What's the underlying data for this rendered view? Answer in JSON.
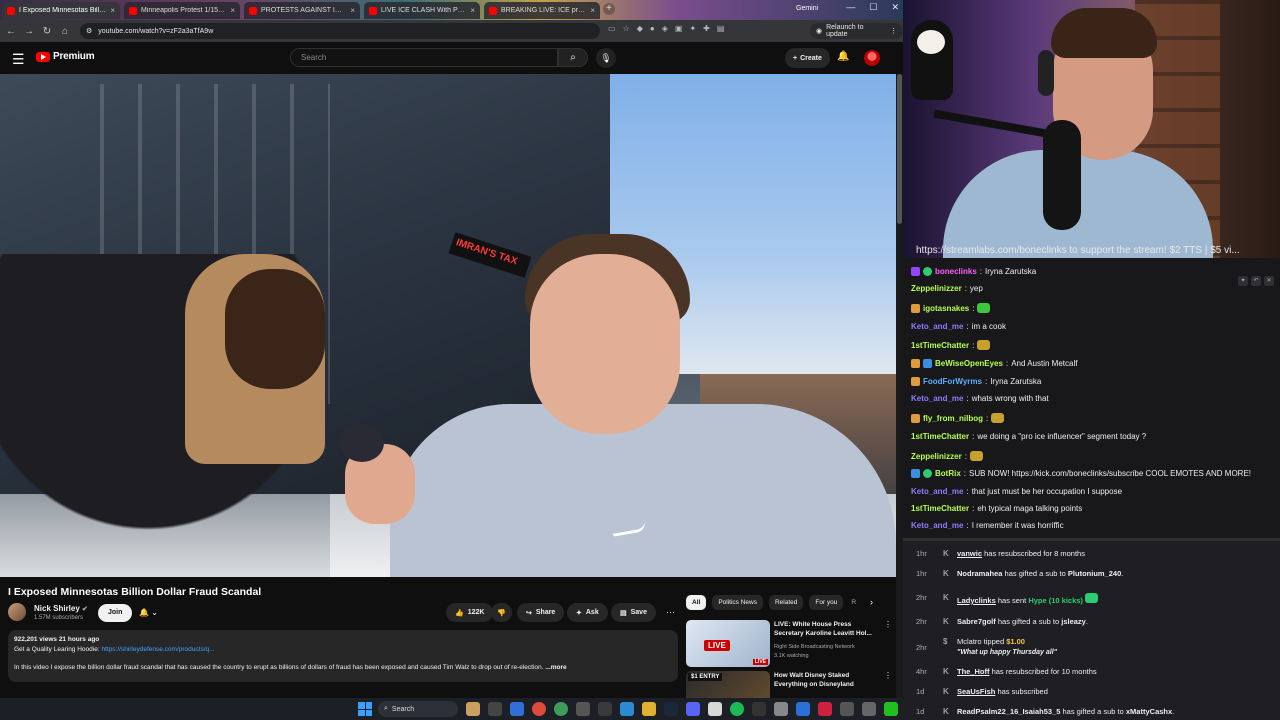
{
  "browser": {
    "tabs": [
      {
        "label": "I Exposed Minnesotas Billion Do",
        "active": true
      },
      {
        "label": "Minneapolis Protest 1/15 - You",
        "active": false
      },
      {
        "label": "PROTESTS AGAINST ICE CONTI",
        "active": false
      },
      {
        "label": "LIVE ICE CLASH With Protester",
        "active": false
      },
      {
        "label": "BREAKING LIVE: ICE protestors",
        "active": false
      }
    ],
    "gemini_label": "Gemini",
    "url": "youtube.com/watch?v=zF2a3aTfA9w",
    "relaunch_label": "Relaunch to update"
  },
  "youtube": {
    "logo": "Premium",
    "search_placeholder": "Search",
    "create_label": "Create",
    "video_title": "I Exposed Minnesotas Billion Dollar Fraud Scandal",
    "channel": {
      "name": "Nick Shirley",
      "subscribers": "1.57M subscribers",
      "join_label": "Join"
    },
    "actions": {
      "likes": "122K",
      "share": "Share",
      "ask": "Ask",
      "save": "Save"
    },
    "description": {
      "meta": "922,201 views  21 hours ago",
      "line1_prefix": "Get a Quality Learing Hoodie: ",
      "link": "https://shirleydefense.com/products/q...",
      "line2": "In this video I expose the billion dollar fraud scandal that has caused the country to erupt as billions of dollars of fraud has been exposed and caused Tim Walz to drop out of re-election.",
      "more": "...more"
    },
    "chips": [
      "All",
      "Politics News",
      "Related",
      "For you",
      "R"
    ],
    "recommendations": [
      {
        "title": "LIVE: White House Press Secretary Karoline Leavitt Hol...",
        "channel": "Right Side Broadcasting Network",
        "meta": "3.1K watching",
        "thumb_badge": "LIVE",
        "corner_badge": "LIVE"
      },
      {
        "title": "How Walt Disney Staked Everything on Disneyland",
        "thumb_badge": "$1 ENTRY"
      }
    ]
  },
  "taskbar": {
    "search_label": "Search"
  },
  "stream": {
    "banner": "https://streamlabs.com/boneclinks to support the stream! $2 TTS | $5 vi..."
  },
  "chat": [
    {
      "user": "boneclinks",
      "color": "#ff5cff",
      "text": "Iryna Zarutska"
    },
    {
      "user": "Zeppelinizzer",
      "color": "#b7ff52",
      "text": "yep"
    },
    {
      "user": "igotasnakes",
      "color": "#b7ff52",
      "text": ""
    },
    {
      "user": "Keto_and_me",
      "color": "#8e7cff",
      "text": "im a cook"
    },
    {
      "user": "1stTimeChatter",
      "color": "#b7ff52",
      "text": ""
    },
    {
      "user": "BeWiseOpenEyes",
      "color": "#b7ff52",
      "text": "And Austin Metcalf"
    },
    {
      "user": "FoodForWyrms",
      "color": "#5bb0ff",
      "text": "Iryna Zarutska"
    },
    {
      "user": "Keto_and_me",
      "color": "#8e7cff",
      "text": "whats wrong with that"
    },
    {
      "user": "fly_from_nilbog",
      "color": "#b7ff52",
      "text": ""
    },
    {
      "user": "1stTimeChatter",
      "color": "#b7ff52",
      "text": "we doing a \"pro ice influencer\" segment today ?"
    },
    {
      "user": "Zeppelinizzer",
      "color": "#b7ff52",
      "text": ""
    },
    {
      "user": "BotRix",
      "color": "#b7ff52",
      "text": "SUB NOW! https://kick.com/boneclinks/subscribe COOL EMOTES AND MORE!"
    },
    {
      "user": "Keto_and_me",
      "color": "#8e7cff",
      "text": "that just must be her occupation I suppose"
    },
    {
      "user": "1stTimeChatter",
      "color": "#b7ff52",
      "text": "eh typical maga talking points"
    },
    {
      "user": "Keto_and_me",
      "color": "#8e7cff",
      "text": "I remember it was horriffic"
    }
  ],
  "events": [
    {
      "time": "1hr",
      "user": "vanwic",
      "text": " has resubscribed for 8 months"
    },
    {
      "time": "1hr",
      "user": "Nodramahea",
      "text": " has gifted a sub to ",
      "target": "Plutonium_240",
      "suffix": "."
    },
    {
      "time": "2hr",
      "user": "Ladyclinks",
      "text": " has sent ",
      "hype": "Hype (10 kicks)"
    },
    {
      "time": "2hr",
      "user": "Sabre7golf",
      "text": " has gifted a sub to ",
      "target": "jsleazy",
      "suffix": "."
    },
    {
      "time": "2hr",
      "user": "Mclatro",
      "text": " tipped ",
      "amount": "$1.00",
      "quote": "\"What up happy Thursday all\""
    },
    {
      "time": "4hr",
      "user": "The_Hoff",
      "text": " has resubscribed for 10 months"
    },
    {
      "time": "1d",
      "user": "SeaUsFish",
      "text": " has subscribed"
    },
    {
      "time": "1d",
      "user": "ReadPsalm22_16_Isaiah53_5",
      "text": " has gifted a sub to ",
      "target": "xMattyCashx",
      "suffix": "."
    }
  ]
}
